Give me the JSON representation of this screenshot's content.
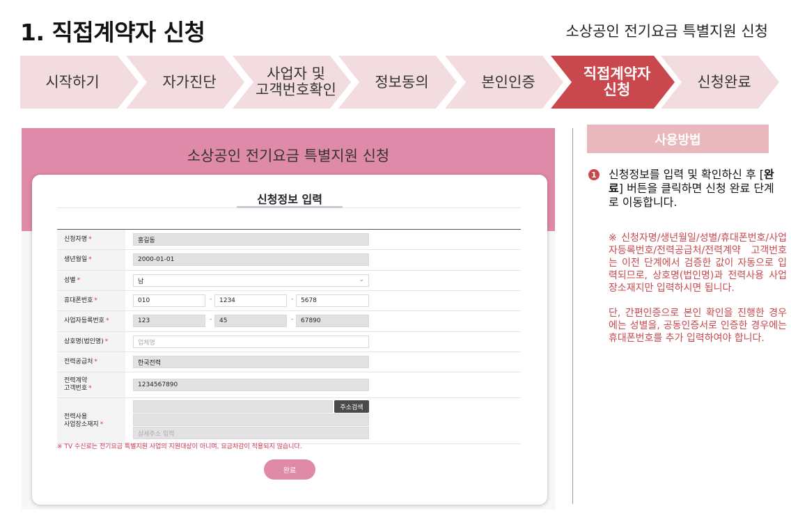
{
  "page": {
    "title": "1. 직접계약자 신청",
    "subtitle": "소상공인 전기요금 특별지원 신청"
  },
  "steps": [
    {
      "line1": "시작하기",
      "line2": ""
    },
    {
      "line1": "자가진단",
      "line2": ""
    },
    {
      "line1": "사업자 및",
      "line2": "고객번호확인"
    },
    {
      "line1": "정보동의",
      "line2": ""
    },
    {
      "line1": "본인인증",
      "line2": ""
    },
    {
      "line1": "직접계약자",
      "line2": "신청"
    },
    {
      "line1": "신청완료",
      "line2": ""
    }
  ],
  "form": {
    "header": "소상공인 전기요금 특별지원 신청",
    "section_title": "신청정보 입력",
    "required_mark": "*",
    "fields": {
      "name": {
        "label": "신청자명",
        "value": "홍길동"
      },
      "birth": {
        "label": "생년월일",
        "value": "2000-01-01"
      },
      "gender": {
        "label": "성별",
        "value": "남"
      },
      "phone": {
        "label": "휴대폰번호",
        "p1": "010",
        "p2": "1234",
        "p3": "5678"
      },
      "biz": {
        "label": "사업자등록번호",
        "p1": "123",
        "p2": "45",
        "p3": "67890"
      },
      "company": {
        "label": "상호명(법인명)",
        "placeholder": "업체명"
      },
      "supplier": {
        "label": "전력공급처",
        "value": "한국전력"
      },
      "customer": {
        "label1": "전력계약",
        "label2": "고객번호",
        "value": "1234567890"
      },
      "address": {
        "label1": "전력사용",
        "label2": "사업장소재지",
        "search_button": "주소검색",
        "detail_placeholder": "상세주소 입력"
      }
    },
    "dash": "-",
    "chevron": "⌄",
    "notice": "※ TV 수신료는 전기요금 특별지원 사업의 지원대상이 아니며, 요금차감이 적용되지 않습니다.",
    "submit": "완료"
  },
  "guide": {
    "header": "사용방법",
    "number": "1",
    "text_before": "신청정보를 입력 및 확인하신 후 [",
    "text_bold": "완료",
    "text_after": "] 버튼을 클릭하면 신청 완료 단계로 이동합니다.",
    "note1": "※ 신청자명/생년월일/성별/휴대폰번호/사업자등록번호/전력공급처/전력계약 고객번호는 이전 단계에서 검증한 값이 자동으로 입력되므로, 상호명(법인명)과 전력사용 사업장소재지만 입력하시면 됩니다.",
    "note2": "단, 간편인증으로 본인 확인을 진행한 경우에는 성별을, 공동인증서로 인증한 경우에는 휴대폰번호를 추가 입력하여야 합니다."
  },
  "colors": {
    "active_step": "#c9484d",
    "step_bg": "#f2dcdf",
    "panel_header": "#df8aa8",
    "required": "#d0314d"
  }
}
